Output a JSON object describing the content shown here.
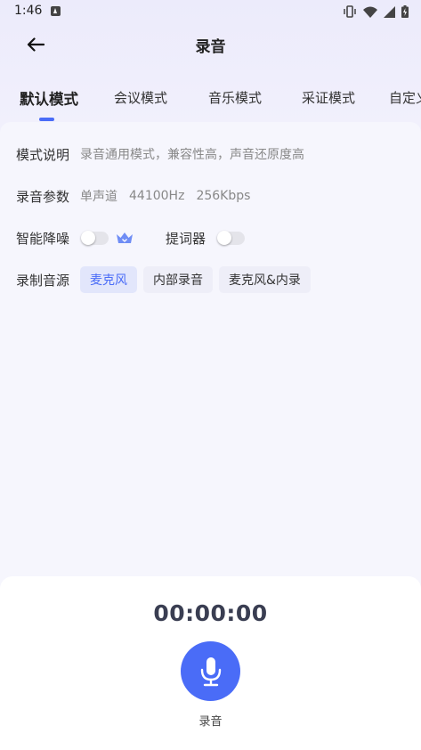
{
  "status_bar": {
    "time": "1:46"
  },
  "header": {
    "title": "录音"
  },
  "tabs": [
    {
      "label": "默认模式"
    },
    {
      "label": "会议模式"
    },
    {
      "label": "音乐模式"
    },
    {
      "label": "采证模式"
    },
    {
      "label": "自定义"
    }
  ],
  "mode_description": {
    "label": "模式说明",
    "text": "录音通用模式，兼容性高，声音还原度高"
  },
  "record_params": {
    "label": "录音参数",
    "channel": "单声道",
    "sample_rate": "44100Hz",
    "bitrate": "256Kbps"
  },
  "noise_reduction": {
    "label": "智能降噪",
    "enabled": false
  },
  "prompter": {
    "label": "提词器",
    "enabled": false
  },
  "source": {
    "label": "录制音源",
    "options": [
      "麦克风",
      "内部录音",
      "麦克风&内录"
    ],
    "selected": "麦克风"
  },
  "recorder": {
    "timer": "00:00:00",
    "label": "录音"
  },
  "colors": {
    "accent": "#4a6cf7",
    "background": "#f5f5fd"
  }
}
